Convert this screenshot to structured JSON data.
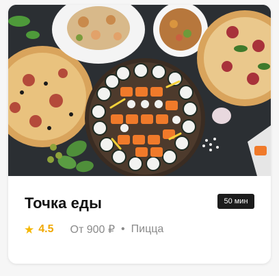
{
  "restaurant": {
    "name": "Точка еды",
    "delivery_time": "50 мин",
    "rating": "4.5",
    "price_from": "От 900 ₽",
    "separator": "•",
    "category": "Пицца",
    "star_icon": "star-icon"
  },
  "colors": {
    "accent": "#f5b700",
    "badge_bg": "#1c1c1c"
  }
}
